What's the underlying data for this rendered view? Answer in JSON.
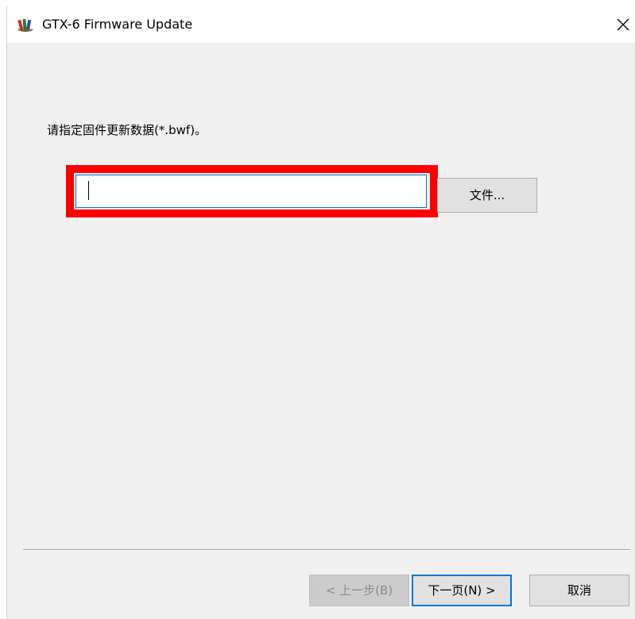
{
  "window": {
    "title": "GTX-6 Firmware Update",
    "close_glyph": "×",
    "app_icon": "winrar-style-books-icon"
  },
  "form": {
    "prompt": "请指定固件更新数据(*.bwf)。",
    "file_path_value": "",
    "file_path_placeholder": "",
    "browse_label": "文件..."
  },
  "footer": {
    "back_label": "< 上一步(B)",
    "next_label": "下一页(N) >",
    "cancel_label": "取消"
  },
  "colors": {
    "highlight": "#ff0000",
    "focus_border": "#0078d7",
    "dialog_background": "#f0f0f0"
  }
}
